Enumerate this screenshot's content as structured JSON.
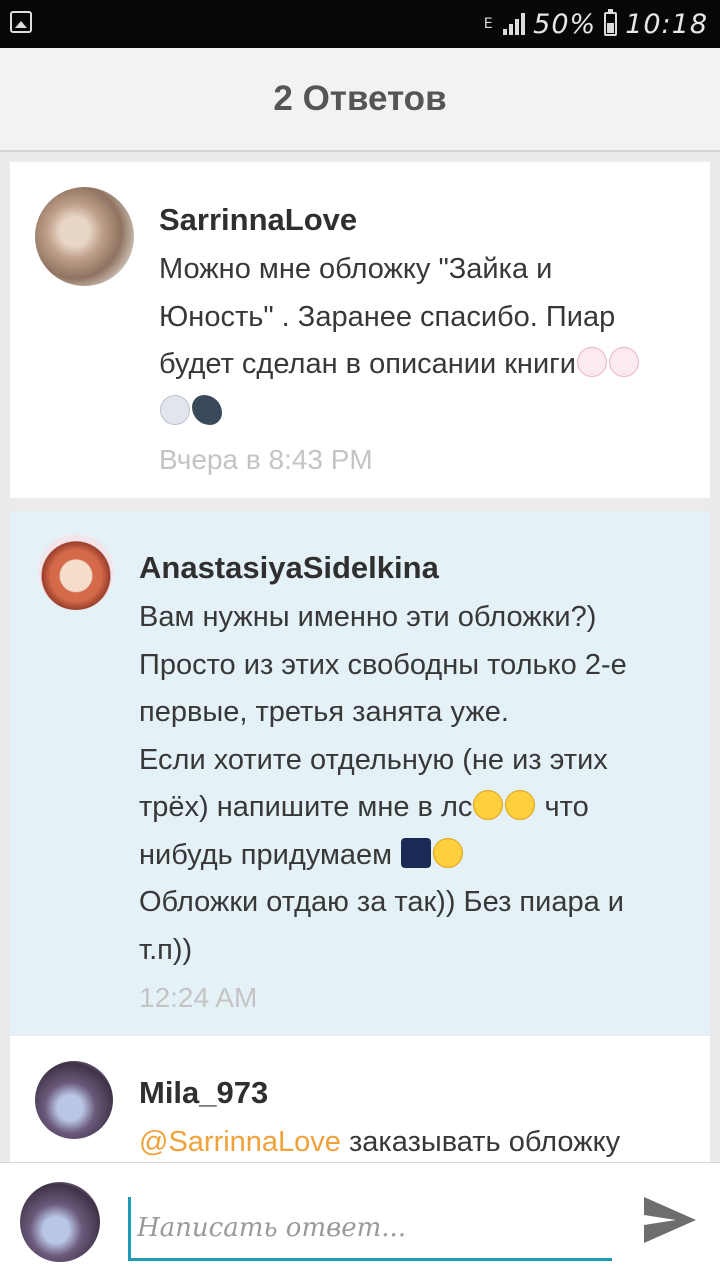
{
  "status_bar": {
    "network": "E",
    "battery_text": "50%",
    "battery_level": 0.5,
    "time": "10:18",
    "icons": [
      "gallery-icon",
      "network-type-icon",
      "signal-icon",
      "battery-icon"
    ]
  },
  "header": {
    "title": "2 Ответов"
  },
  "comments": [
    {
      "author": "SarrinnaLove",
      "lines": [
        "Можно мне обложку \"Зайка и",
        "Юность\" . Заранее спасибо. Пиар",
        "будет сделан в описании книги"
      ],
      "time": "Вчера в 8:43 PM",
      "emojis": [
        "rabbit-face-emoji",
        "rabbit-face-emoji",
        "heart-eyes-cat-emoji",
        "dolphin-emoji"
      ]
    },
    {
      "author": "AnastasiyaSidelkina",
      "lines": [
        "Вам нужны именно эти обложки?)",
        "Просто из этих свободны только 2-е",
        "первые, третья занята уже.",
        "Если хотите отдельную (не из этих",
        "трёх) напишите мне в лс",
        "что",
        "нибудь придумаем",
        "Обложки отдаю за так)) Без пиара и",
        "т.п))"
      ],
      "time": "12:24 AM",
      "emojis": [
        "smiling-face-emoji",
        "kissing-face-emoji",
        "fireworks-emoji",
        "smiling-face-emoji"
      ]
    },
    {
      "author": "Mila_973",
      "mention": "@SarrinnaLove",
      "text": " заказывать обложку"
    }
  ],
  "reply": {
    "placeholder": "Написать ответ...",
    "send_icon": "send-icon"
  },
  "colors": {
    "highlight_bg": "#e4f2f7",
    "accent": "#1f9bb5",
    "mention": "#f0a13a"
  }
}
